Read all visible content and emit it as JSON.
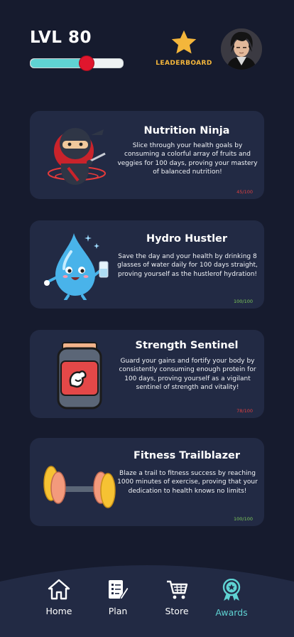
{
  "header": {
    "level_text": "LVL 80",
    "xp_progress": 0.6,
    "leaderboard_label": "LEADERBOARD"
  },
  "cards": [
    {
      "title": "Nutrition Ninja",
      "description": "Slice through your health goals by consuming a colorful array of fruits and veggies for 100 days, proving your mastery of balanced nutrition!",
      "progress": "45/100",
      "progress_color": "#e04040",
      "icon": "ninja-icon"
    },
    {
      "title": "Hydro Hustler",
      "description": "Save the day and your health by drinking 8 glasses of water daily for 100 days straight, proving yourself as the hustlerof hydration!",
      "progress": "100/100",
      "progress_color": "#7ecb5a",
      "icon": "water-drop-icon"
    },
    {
      "title": "Strength Sentinel",
      "description": "Guard your gains and fortify your body by consistently consuming enough protein for 100 days, proving yourself as a vigilant sentinel of strength and vitality!",
      "progress": "78/100",
      "progress_color": "#e04040",
      "icon": "protein-jar-icon"
    },
    {
      "title": "Fitness Trailblazer",
      "description": "Blaze a trail to fitness success by reaching 1000 minutes of exercise, proving that your dedication to health knows no limits!",
      "progress": "100/100",
      "progress_color": "#7ecb5a",
      "icon": "dumbbell-icon"
    }
  ],
  "nav": {
    "items": [
      {
        "label": "Home",
        "icon": "home-icon"
      },
      {
        "label": "Plan",
        "icon": "plan-icon"
      },
      {
        "label": "Store",
        "icon": "cart-icon"
      },
      {
        "label": "Awards",
        "icon": "award-icon"
      }
    ],
    "active_index": 3,
    "active_color": "#5fd3d3"
  },
  "colors": {
    "background": "#161b2e",
    "card": "#222a44",
    "accent_gold": "#f4b63b",
    "xp_fill": "#5fd3d3",
    "xp_knob": "#e0162d"
  }
}
